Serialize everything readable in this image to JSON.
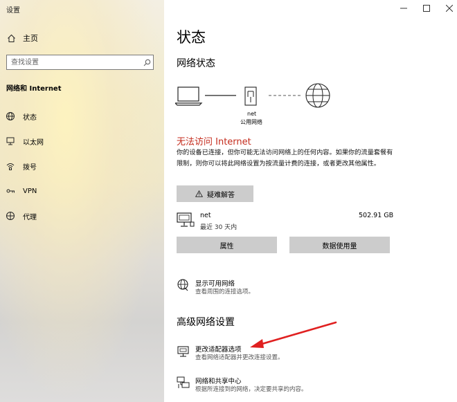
{
  "window": {
    "title": "设置",
    "controls": {
      "minimize": "—",
      "maximize": "☐",
      "close": "✕"
    }
  },
  "sidebar": {
    "home_label": "主页",
    "search": {
      "placeholder": "查找设置",
      "value": ""
    },
    "section_header": "网络和 Internet",
    "items": [
      {
        "label": "状态",
        "icon": "status-icon"
      },
      {
        "label": "以太网",
        "icon": "ethernet-icon"
      },
      {
        "label": "拨号",
        "icon": "dialup-icon"
      },
      {
        "label": "VPN",
        "icon": "vpn-icon"
      },
      {
        "label": "代理",
        "icon": "proxy-icon"
      }
    ]
  },
  "main": {
    "title": "状态",
    "network_status_title": "网络状态",
    "diagram": {
      "network_name": "net",
      "network_type": "公用网络"
    },
    "status_heading": "无法访问 Internet",
    "status_description": "你的设备已连接，但你可能无法访问网络上的任何内容。如果你的流量套餐有限制，则你可以将此网络设置为按流量计费的连接，或者更改其他属性。",
    "troubleshoot_label": "疑难解答",
    "connection": {
      "name": "net",
      "time": "最近 30 天内",
      "usage": "502.91 GB"
    },
    "properties_label": "属性",
    "data_usage_label": "数据使用量",
    "show_networks": {
      "title": "显示可用网络",
      "subtitle": "查看周围的连接选项。"
    },
    "advanced_title": "高级网络设置",
    "adapter_options": {
      "title": "更改适配器选项",
      "subtitle": "查看网络适配器并更改连接设置。"
    },
    "sharing_center": {
      "title": "网络和共享中心",
      "subtitle": "根据所连接到的网络，决定要共享的内容。"
    }
  },
  "colors": {
    "error_red": "#c42b1c",
    "button_gray": "#cccccc",
    "annotation_red": "#e02020"
  }
}
